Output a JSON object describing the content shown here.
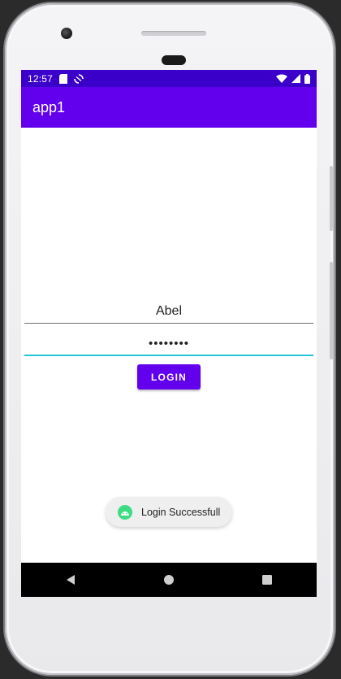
{
  "status_bar": {
    "time": "12:57",
    "icons_left": [
      "sd-card-icon",
      "sync-icon"
    ],
    "icons_right": [
      "wifi-icon",
      "signal-icon",
      "battery-icon"
    ],
    "background": "#3a00c9"
  },
  "app_bar": {
    "title": "app1",
    "background": "#6200ee"
  },
  "form": {
    "username_value": "Abel",
    "password_value": "••••••••",
    "login_label": "LOGIN",
    "accent": "#26c6da"
  },
  "toast": {
    "text": "Login Successfull",
    "icon": "android-icon",
    "icon_color": "#3ddc84"
  },
  "nav_bar": {
    "buttons": [
      "back-icon",
      "home-icon",
      "recents-icon"
    ]
  }
}
